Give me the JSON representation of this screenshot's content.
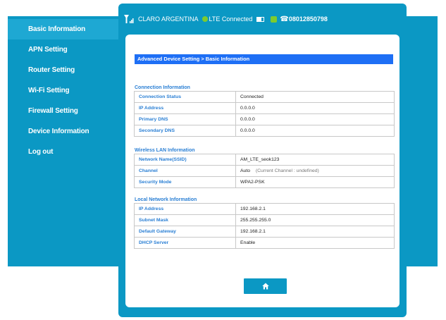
{
  "status": {
    "operator": "CLARO ARGENTINA",
    "network": "LTE Connected",
    "phone": "08012850798",
    "signal_icon": "signal-bars-icon",
    "battery_icon": "battery-icon"
  },
  "sidebar": {
    "items": [
      {
        "label": "Basic Information",
        "active": true
      },
      {
        "label": "APN Setting"
      },
      {
        "label": "Router Setting"
      },
      {
        "label": "Wi-Fi Setting"
      },
      {
        "label": "Firewall Setting"
      },
      {
        "label": "Device Information"
      },
      {
        "label": "Log out"
      }
    ]
  },
  "page": {
    "title": "Advanced Device Setting > Basic Information"
  },
  "connection": {
    "heading": "Connection Information",
    "rows": [
      {
        "label": "Connection Status",
        "value": "Connected"
      },
      {
        "label": "IP Address",
        "value": "0.0.0.0"
      },
      {
        "label": "Primary DNS",
        "value": "0.0.0.0"
      },
      {
        "label": "Secondary DNS",
        "value": "0.0.0.0"
      }
    ]
  },
  "wlan": {
    "heading": "Wireless LAN Information",
    "ssid_label": "Network Name(SSID)",
    "ssid_value": "AM_LTE_seok123",
    "channel_label": "Channel",
    "channel_value": "Auto",
    "channel_note": "(Current Channel : undefined)",
    "security_label": "Security Mode",
    "security_value": "WPA2-PSK"
  },
  "lan": {
    "heading": "Local Network Information",
    "rows": [
      {
        "label": "IP Address",
        "value": "192.168.2.1"
      },
      {
        "label": "Subnet Mask",
        "value": "255.255.255.0"
      },
      {
        "label": "Default Gateway",
        "value": "192.168.2.1"
      },
      {
        "label": "DHCP Server",
        "value": "Enable"
      }
    ]
  },
  "home_button": {
    "icon": "home-icon"
  },
  "colors": {
    "accent": "#0b98c4",
    "title_bar": "#1e6ff5",
    "label_text": "#2a7fd4"
  }
}
